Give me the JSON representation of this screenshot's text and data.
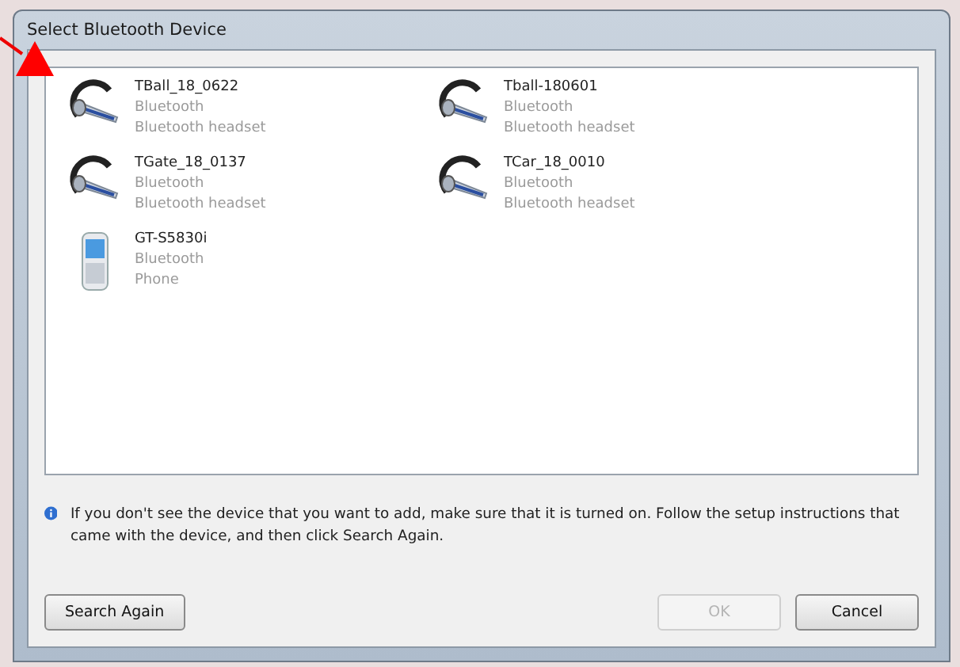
{
  "window": {
    "title": "Select Bluetooth Device"
  },
  "devices": [
    {
      "name": "TBall_18_0622",
      "type": "Bluetooth",
      "category": "Bluetooth headset",
      "kind": "headset"
    },
    {
      "name": "Tball-180601",
      "type": "Bluetooth",
      "category": "Bluetooth headset",
      "kind": "headset"
    },
    {
      "name": "TGate_18_0137",
      "type": "Bluetooth",
      "category": "Bluetooth headset",
      "kind": "headset"
    },
    {
      "name": "TCar_18_0010",
      "type": "Bluetooth",
      "category": "Bluetooth headset",
      "kind": "headset"
    },
    {
      "name": "GT-S5830i",
      "type": "Bluetooth",
      "category": "Phone",
      "kind": "phone"
    }
  ],
  "info": "If you don't see the device that you want to add, make sure that it is turned on. Follow the setup instructions that came with the device, and then click Search Again.",
  "buttons": [
    {
      "label": "Search Again",
      "disabled": false
    },
    {
      "label": "OK",
      "disabled": true
    },
    {
      "label": "Cancel",
      "disabled": false
    }
  ]
}
